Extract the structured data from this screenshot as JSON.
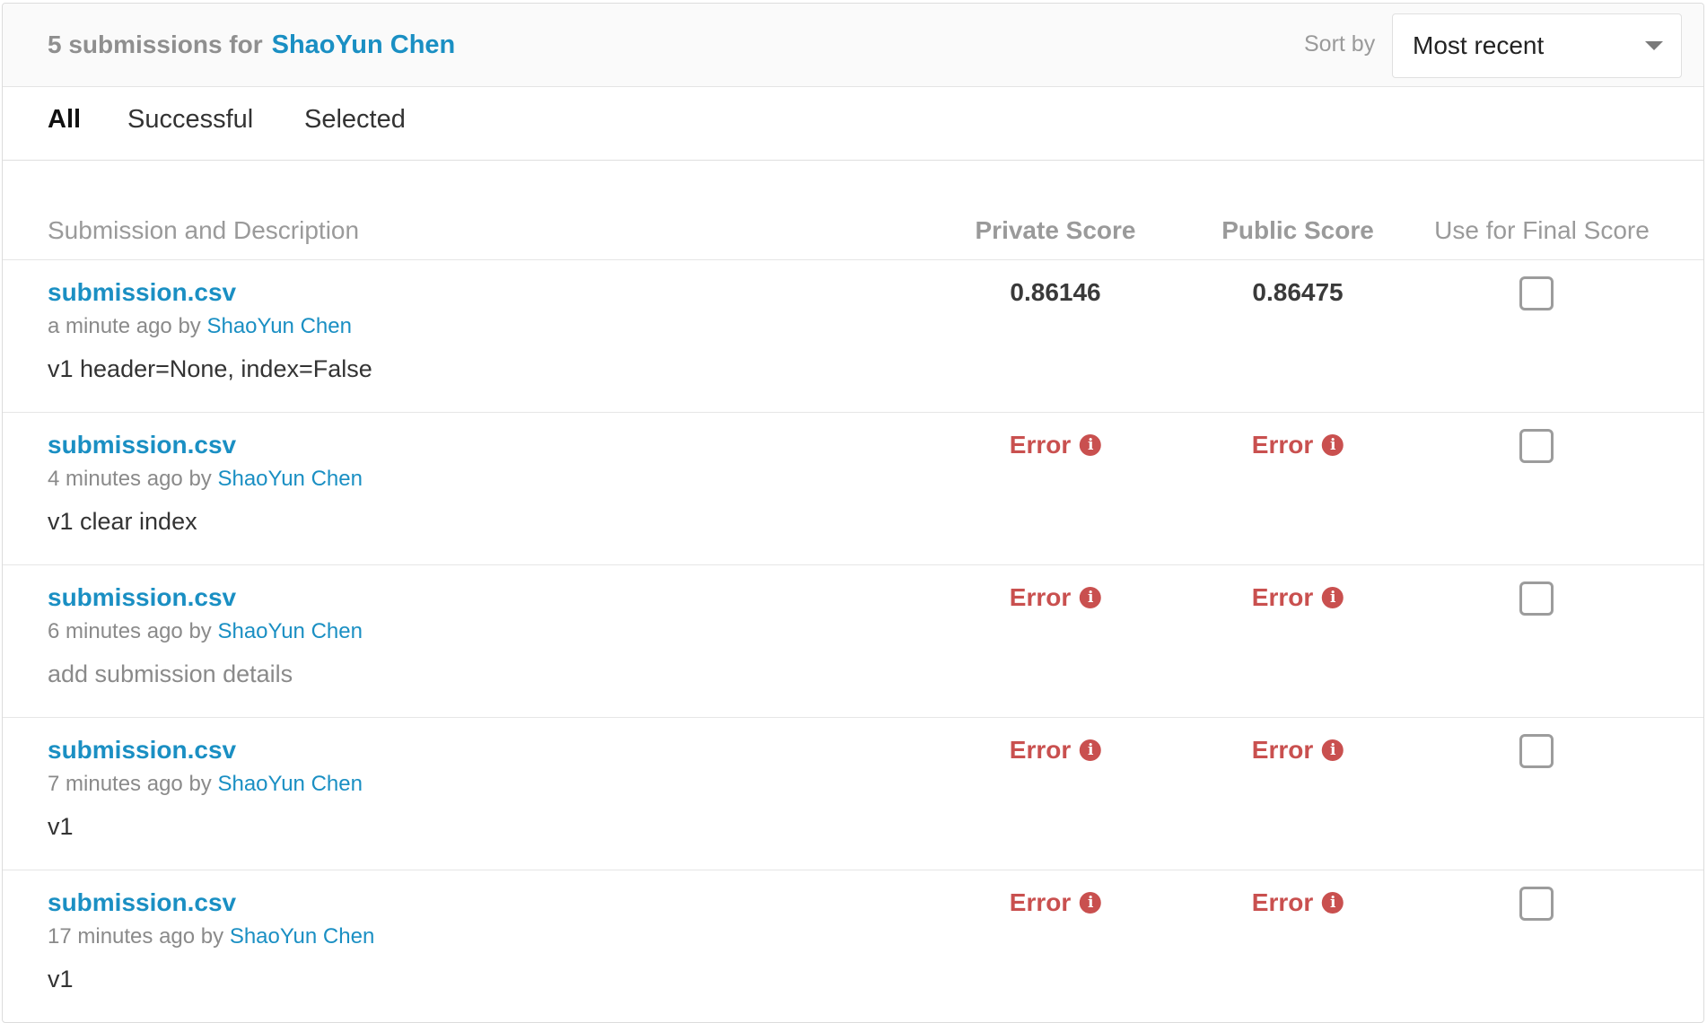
{
  "header": {
    "count_text": "5 submissions for",
    "user_name": "ShaoYun Chen",
    "sort_label": "Sort by",
    "sort_value": "Most recent"
  },
  "tabs": [
    {
      "label": "All",
      "active": true
    },
    {
      "label": "Successful",
      "active": false
    },
    {
      "label": "Selected",
      "active": false
    }
  ],
  "columns": {
    "submission": "Submission and Description",
    "private": "Private Score",
    "public": "Public Score",
    "final": "Use for Final Score"
  },
  "submissions": [
    {
      "file": "submission.csv",
      "time": "a minute ago",
      "by": "by",
      "author": "ShaoYun Chen",
      "description": "v1 header=None, index=False",
      "private": "0.86146",
      "public": "0.86475",
      "private_error": false,
      "public_error": false
    },
    {
      "file": "submission.csv",
      "time": "4 minutes ago",
      "by": "by",
      "author": "ShaoYun Chen",
      "description": "v1 clear index",
      "private": "Error",
      "public": "Error",
      "private_error": true,
      "public_error": true
    },
    {
      "file": "submission.csv",
      "time": "6 minutes ago",
      "by": "by",
      "author": "ShaoYun Chen",
      "description": "add submission details",
      "private": "Error",
      "public": "Error",
      "private_error": true,
      "public_error": true
    },
    {
      "file": "submission.csv",
      "time": "7 minutes ago",
      "by": "by",
      "author": "ShaoYun Chen",
      "description": "v1",
      "private": "Error",
      "public": "Error",
      "private_error": true,
      "public_error": true
    },
    {
      "file": "submission.csv",
      "time": "17 minutes ago",
      "by": "by",
      "author": "ShaoYun Chen",
      "description": "v1",
      "private": "Error",
      "public": "Error",
      "private_error": true,
      "public_error": true
    }
  ],
  "icons": {
    "info": "info-icon",
    "dropdown": "chevron-down-icon"
  },
  "colors": {
    "link": "#1a8fc3",
    "error": "#c9504f",
    "muted": "#8a8a8a"
  }
}
